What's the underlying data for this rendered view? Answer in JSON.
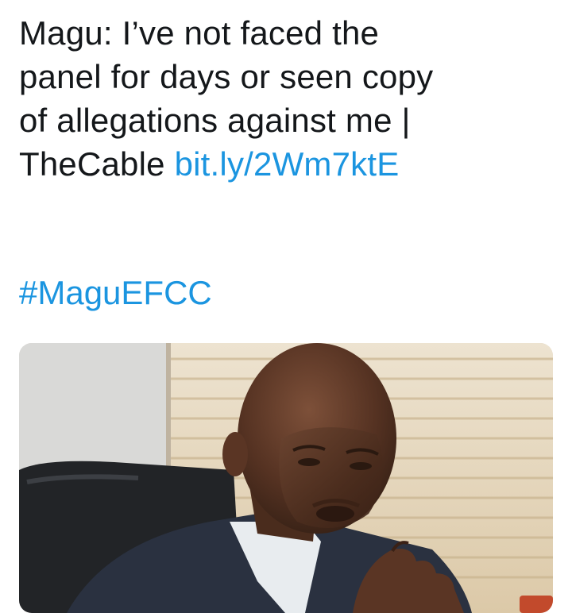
{
  "tweet": {
    "line1": "Magu: I’ve not faced the",
    "line2": "panel for days or seen copy",
    "line3": "of allegations against me |",
    "line4_text": "TheCable ",
    "link": "bit.ly/2Wm7ktE",
    "hashtag": "#MaguEFCC"
  },
  "media": {
    "description_icon": "photo-of-man-speaking"
  }
}
